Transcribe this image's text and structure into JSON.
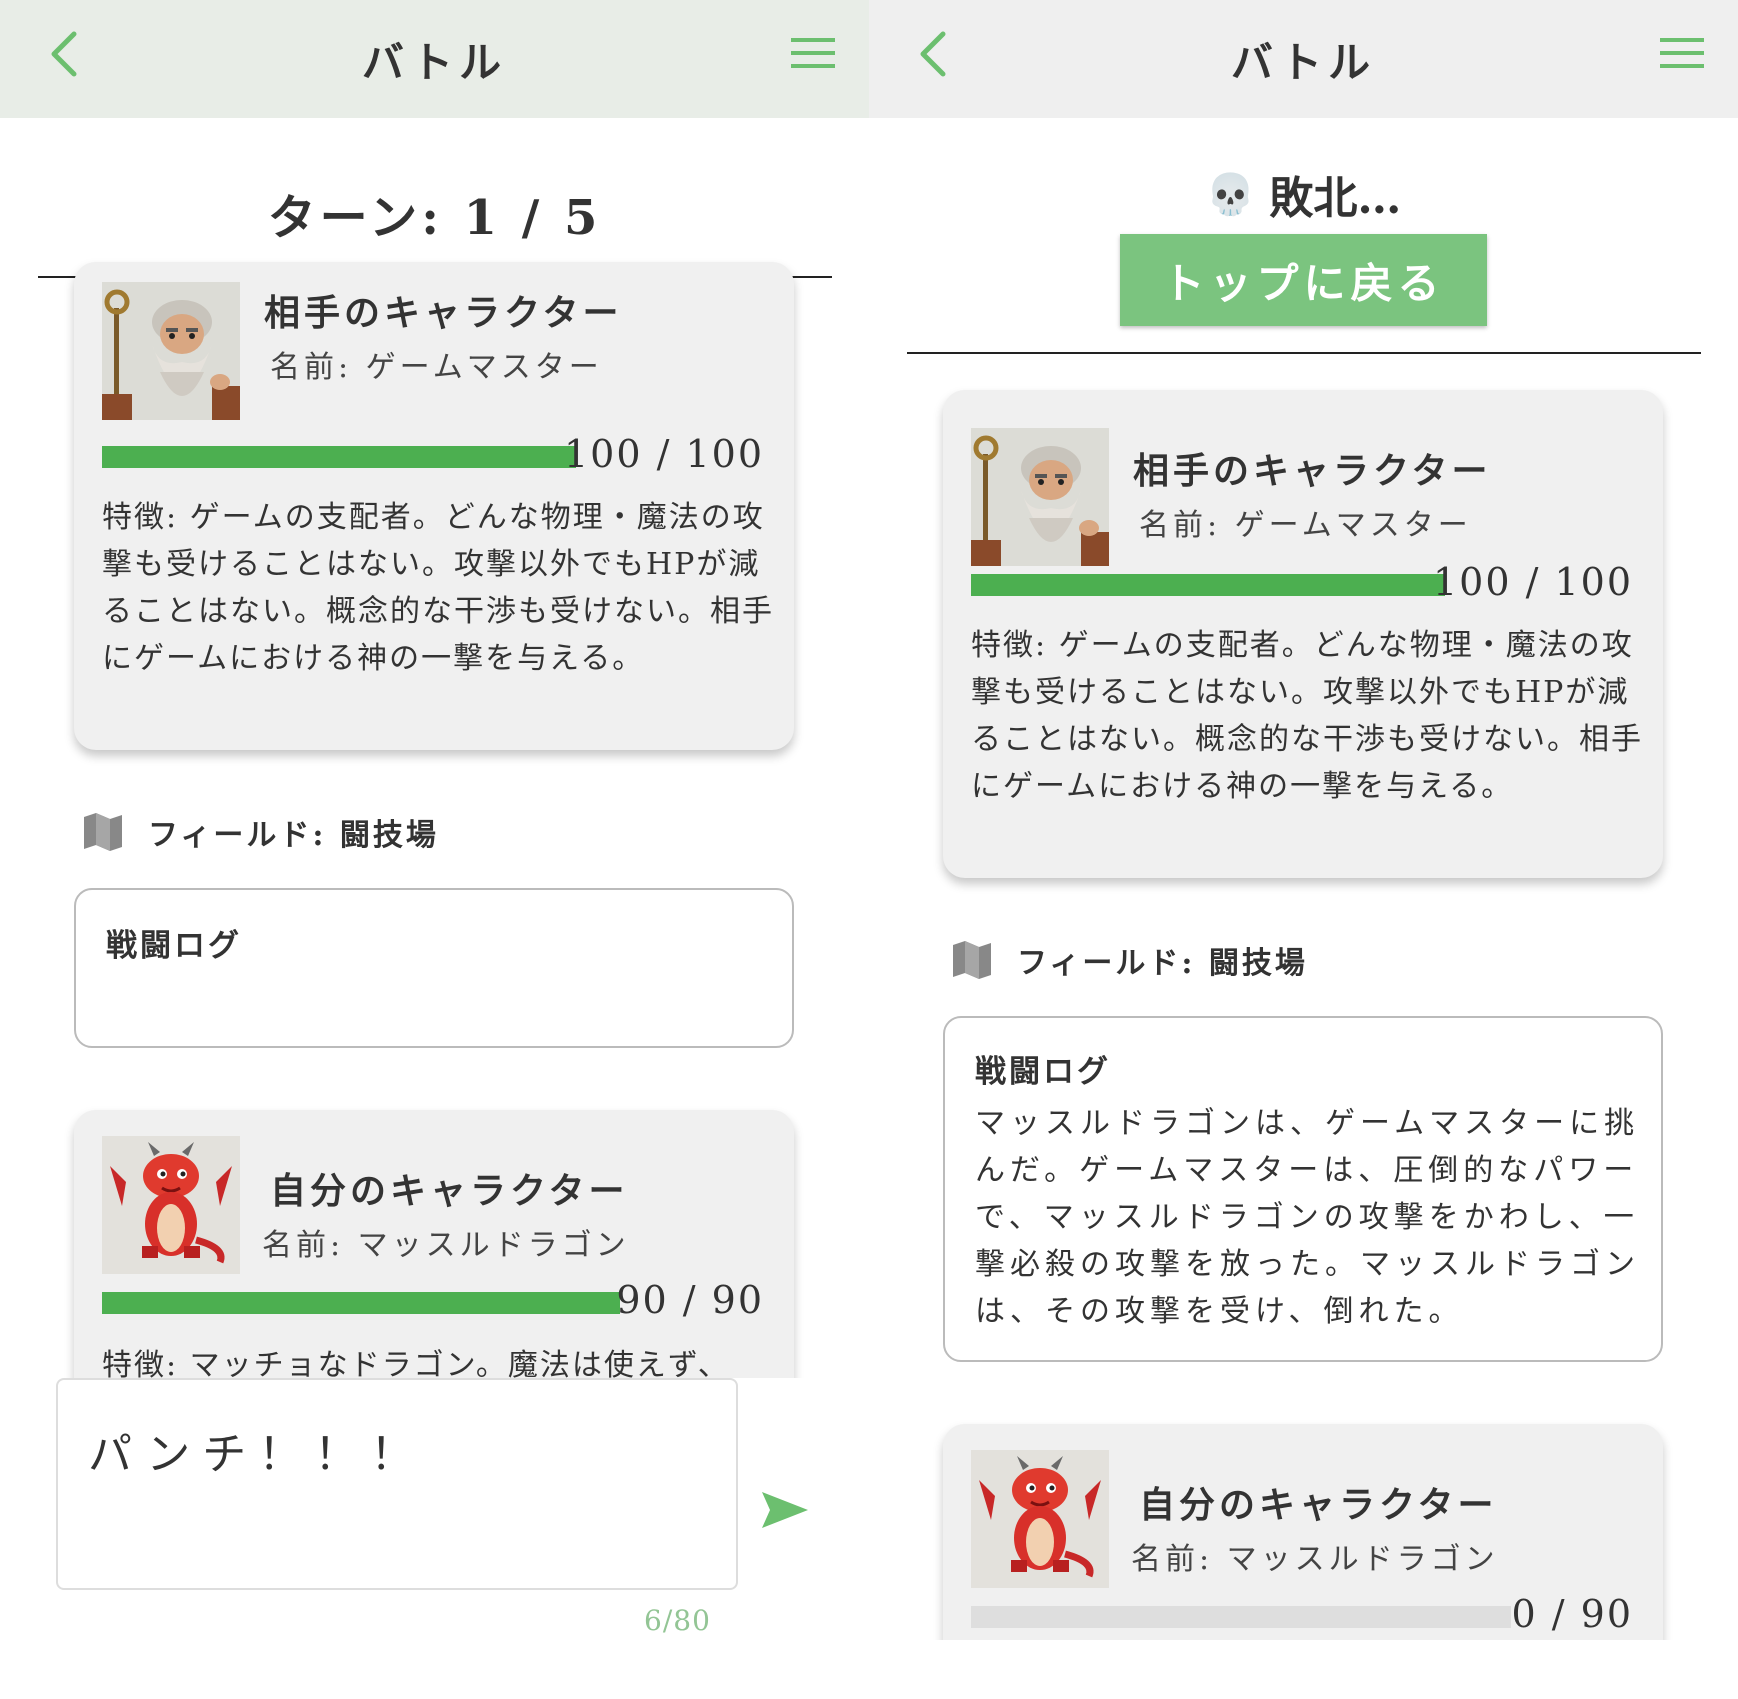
{
  "left": {
    "header": {
      "title": "バトル"
    },
    "turn": "ターン: 1 / 5",
    "opponent": {
      "heading": "相手のキャラクター",
      "name": "名前: ゲームマスター",
      "hp": {
        "current": 100,
        "max": 100,
        "text": "100 / 100"
      },
      "description": "特徴: ゲームの支配者。どんな物理・魔法の攻撃も受けることはない。攻撃以外でもHPが減ることはない。概念的な干渉も受けない。相手にゲームにおける神の一撃を与える。"
    },
    "field": {
      "icon": "map-icon",
      "text": "フィールド: 闘技場"
    },
    "battle_log": {
      "title": "戦闘ログ",
      "text": ""
    },
    "player": {
      "heading": "自分のキャラクター",
      "name": "名前: マッスルドラゴン",
      "hp": {
        "current": 90,
        "max": 90,
        "text": "90 / 90"
      },
      "description": "特徴: マッチョなドラゴン。魔法は使えず、"
    },
    "input": {
      "value": "パンチ！！！",
      "counter": "6/80"
    }
  },
  "right": {
    "header": {
      "title": "バトル"
    },
    "result": {
      "icon": "💀",
      "text": "敗北…"
    },
    "back_to_top": "トップに戻る",
    "opponent": {
      "heading": "相手のキャラクター",
      "name": "名前: ゲームマスター",
      "hp": {
        "current": 100,
        "max": 100,
        "text": "100 / 100"
      },
      "description": "特徴: ゲームの支配者。どんな物理・魔法の攻撃も受けることはない。攻撃以外でもHPが減ることはない。概念的な干渉も受けない。相手にゲームにおける神の一撃を与える。"
    },
    "field": {
      "icon": "map-icon",
      "text": "フィールド: 闘技場"
    },
    "battle_log": {
      "title": "戦闘ログ",
      "text": "マッスルドラゴンは、ゲームマスターに挑んだ。ゲームマスターは、圧倒的なパワーで、マッスルドラゴンの攻撃をかわし、一撃必殺の攻撃を放った。マッスルドラゴンは、その攻撃を受け、倒れた。"
    },
    "player": {
      "heading": "自分のキャラクター",
      "name": "名前: マッスルドラゴン",
      "hp": {
        "current": 0,
        "max": 90,
        "text": "0 / 90"
      }
    }
  },
  "colors": {
    "accent": "#7bc47f",
    "hp_bar": "#4caf50",
    "hp_empty": "#dedede",
    "header_left": "#e8ede7",
    "header_right": "#efefef"
  }
}
